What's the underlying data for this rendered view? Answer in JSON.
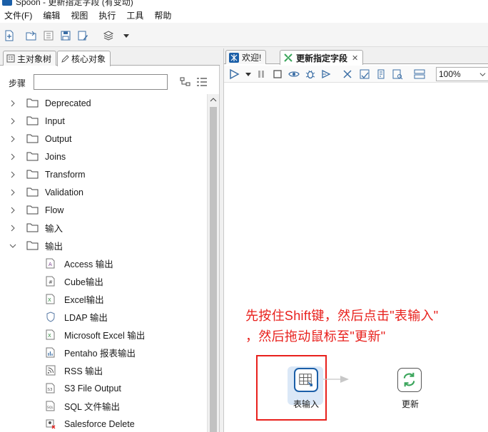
{
  "window": {
    "title": "Spoon - 更新指定字段 (有变动)"
  },
  "menubar": {
    "items": [
      "文件(F)",
      "编辑",
      "视图",
      "执行",
      "工具",
      "帮助"
    ]
  },
  "left_panel": {
    "tabs": [
      {
        "label": "主对象树",
        "active": false
      },
      {
        "label": "核心对象",
        "active": true
      }
    ],
    "steps_label": "步骤",
    "search_value": "",
    "tree": {
      "folders": [
        {
          "label": "Deprecated",
          "expanded": false
        },
        {
          "label": "Input",
          "expanded": false
        },
        {
          "label": "Output",
          "expanded": false
        },
        {
          "label": "Joins",
          "expanded": false
        },
        {
          "label": "Transform",
          "expanded": false
        },
        {
          "label": "Validation",
          "expanded": false
        },
        {
          "label": "Flow",
          "expanded": false
        },
        {
          "label": "输入",
          "expanded": false
        },
        {
          "label": "输出",
          "expanded": true
        }
      ],
      "output_items": [
        {
          "label": "Access 输出",
          "icon": "access-icon"
        },
        {
          "label": "Cube输出",
          "icon": "cube-icon"
        },
        {
          "label": "Excel输出",
          "icon": "excel-icon"
        },
        {
          "label": "LDAP 输出",
          "icon": "ldap-icon"
        },
        {
          "label": "Microsoft Excel 输出",
          "icon": "excel-icon"
        },
        {
          "label": "Pentaho 报表输出",
          "icon": "report-icon"
        },
        {
          "label": "RSS 输出",
          "icon": "rss-icon"
        },
        {
          "label": "S3 File Output",
          "icon": "s3-icon"
        },
        {
          "label": "SQL 文件输出",
          "icon": "sql-file-icon"
        },
        {
          "label": "Salesforce Delete",
          "icon": "salesforce-icon"
        }
      ]
    }
  },
  "right_panel": {
    "tabs": [
      {
        "label": "欢迎!",
        "active": false,
        "closable": false
      },
      {
        "label": "更新指定字段",
        "active": true,
        "closable": true
      }
    ],
    "zoom": "100%",
    "annotation": {
      "line1": "先按住Shift键，然后点击\"表输入\"",
      "line2": "，然后拖动鼠标至\"更新\""
    },
    "steps": [
      {
        "label": "表输入",
        "icon": "table-input-icon"
      },
      {
        "label": "更新",
        "icon": "update-icon"
      }
    ]
  },
  "colors": {
    "annotation_red": "#e8201c",
    "step_blue": "#1b5fa8",
    "update_green": "#3aa55b",
    "selection_bg": "#dbe8f7"
  }
}
